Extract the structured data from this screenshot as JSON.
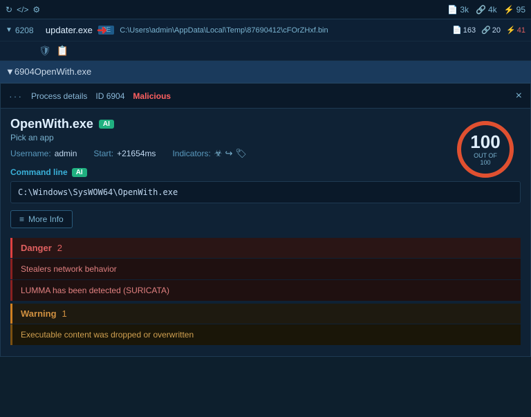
{
  "topbar": {
    "icons": [
      "↻",
      "</>",
      "⚙"
    ],
    "stats": [
      {
        "label": "3k",
        "icon": "📄"
      },
      {
        "label": "4k",
        "icon": "🔗"
      },
      {
        "label": "95",
        "icon": "⚡"
      }
    ]
  },
  "processes": [
    {
      "arrow": "▼",
      "pid": "6208",
      "name": "updater.exe",
      "badge": "PE",
      "path": "C:\\Users\\admin\\AppData\\Local\\Temp\\87690412\\cFOrZHxf.bin",
      "stats": [
        {
          "value": "163",
          "icon": "📄"
        },
        {
          "value": "20",
          "icon": "🔗"
        },
        {
          "value": "41",
          "icon": "⚡",
          "color": "red"
        }
      ]
    }
  ],
  "process2": {
    "arrow": "▼",
    "pid": "6904",
    "name": "OpenWith.exe"
  },
  "panel": {
    "title": "Process details",
    "id_label": "ID 6904",
    "status": "Malicious",
    "close_icon": "×",
    "process_name": "OpenWith.exe",
    "ai_badge": "AI",
    "pick_app": "Pick an app",
    "username_label": "Username:",
    "username_value": "admin",
    "start_label": "Start:",
    "start_value": "+21654ms",
    "indicators_label": "Indicators:",
    "score": {
      "value": "100",
      "out_of": "OUT OF 100"
    },
    "command_line_label": "Command line",
    "ai_badge2": "AI",
    "command_line_value": "C:\\Windows\\SysWOW64\\OpenWith.exe",
    "more_info_label": "More Info",
    "more_info_icon": "≡",
    "danger_title": "Danger",
    "danger_count": "2",
    "danger_items": [
      "Stealers network behavior",
      "LUMMA has been detected (SURICATA)"
    ],
    "warning_title": "Warning",
    "warning_count": "1",
    "warning_items": [
      "Executable content was dropped or overwritten"
    ]
  }
}
